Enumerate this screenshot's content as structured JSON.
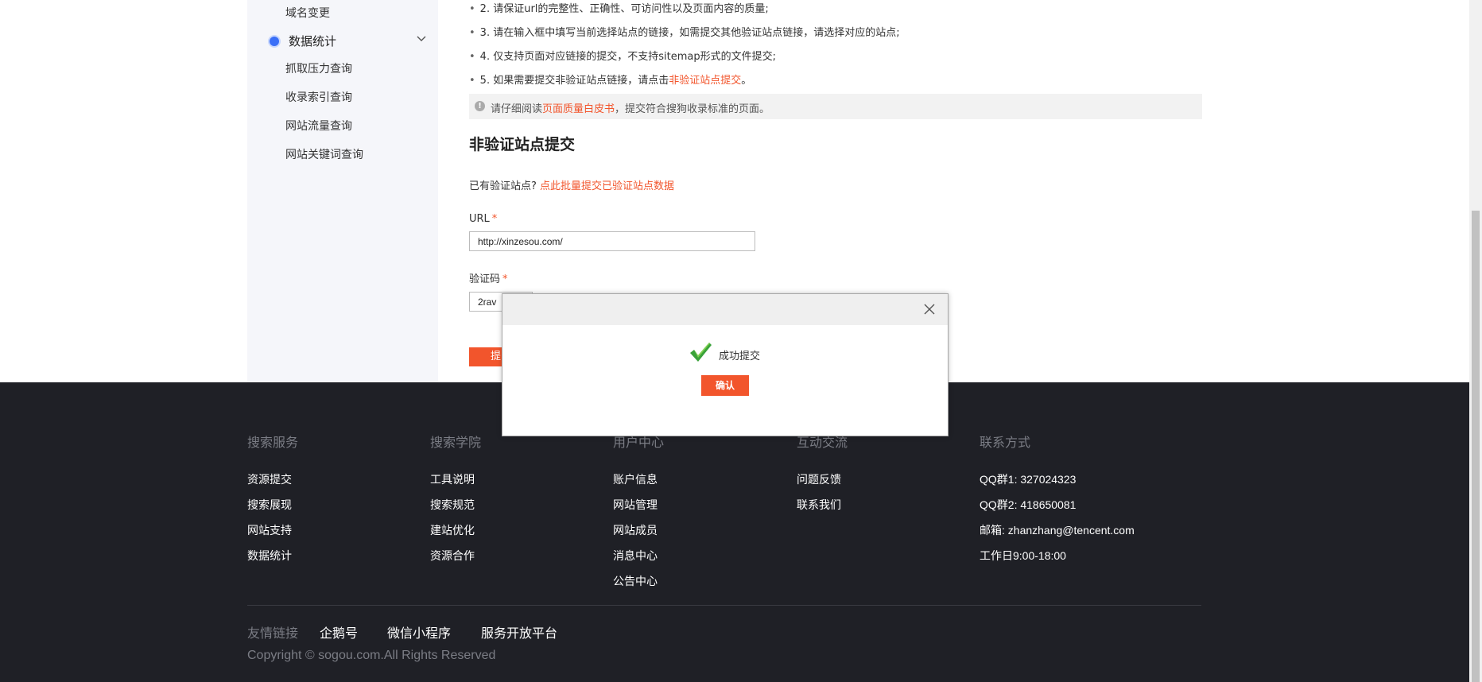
{
  "sidebar": {
    "items_top": [
      "域名变更"
    ],
    "group": {
      "label": "数据统计"
    },
    "items": [
      "抓取压力查询",
      "收录索引查询",
      "网站流量查询",
      "网站关键词查询"
    ]
  },
  "rules": {
    "r2": "2. 请保证url的完整性、正确性、可访问性以及页面内容的质量;",
    "r3": "3. 请在输入框中填写当前选择站点的链接，如需提交其他验证站点链接，请选择对应的站点;",
    "r4": "4. 仅支持页面对应链接的提交，不支持sitemap形式的文件提交;",
    "r5_pre": "5. 如果需要提交非验证站点链接，请点击",
    "r5_link": "非验证站点提交",
    "r5_post": "。"
  },
  "notice": {
    "pre": "请仔细阅读",
    "link": "页面质量白皮书",
    "post": "，提交符合搜狗收录标准的页面。"
  },
  "form": {
    "title": "非验证站点提交",
    "hint_pre": "已有验证站点?",
    "hint_link": "点此批量提交已验证站点数据",
    "url_label": "URL",
    "url_value": "http://xinzesou.com/",
    "captcha_label": "验证码",
    "captcha_value": "2rav",
    "required_mark": "*",
    "submit_label": "提"
  },
  "modal": {
    "message": "成功提交",
    "confirm": "确认"
  },
  "footer": {
    "columns": [
      {
        "title": "搜索服务",
        "links": [
          "资源提交",
          "搜索展现",
          "网站支持",
          "数据统计"
        ]
      },
      {
        "title": "搜索学院",
        "links": [
          "工具说明",
          "搜索规范",
          "建站优化",
          "资源合作"
        ]
      },
      {
        "title": "用户中心",
        "links": [
          "账户信息",
          "网站管理",
          "网站成员",
          "消息中心",
          "公告中心"
        ]
      },
      {
        "title": "互动交流",
        "links": [
          "问题反馈",
          "联系我们"
        ]
      },
      {
        "title": "联系方式",
        "links": [
          "QQ群1: 327024323",
          "QQ群2: 418650081",
          "邮箱: zhanzhang@tencent.com",
          "工作日9:00-18:00"
        ]
      }
    ],
    "friends_label": "友情链接",
    "friends": [
      "企鹅号",
      "微信小程序",
      "服务开放平台"
    ],
    "copyright": "Copyright © sogou.com.All Rights Reserved"
  },
  "colors": {
    "accent": "#f2552c",
    "footer_bg": "#1f2026",
    "sidebar_bg": "#f5f6fa"
  }
}
